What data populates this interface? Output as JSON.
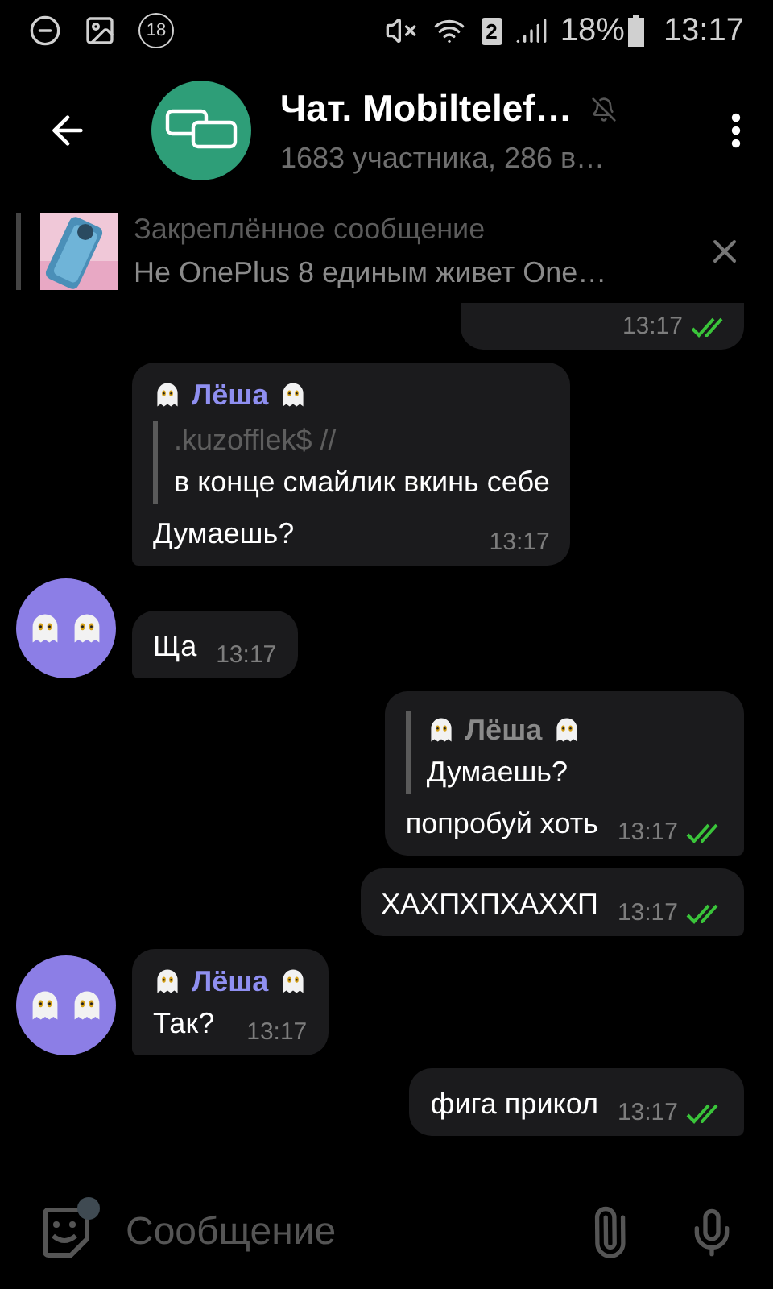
{
  "status_bar": {
    "notification_count": "18",
    "sim": "2",
    "battery": "18%",
    "time": "13:17"
  },
  "header": {
    "title": "Чат. Mobiltelef…",
    "muted": true,
    "subtitle": "1683 участника, 286 в…"
  },
  "pinned": {
    "label": "Закреплённое сообщение",
    "text": "Не OnePlus 8 единым живет One…"
  },
  "messages": [
    {
      "kind": "cut",
      "outgoing": true,
      "time": "13:17",
      "read": true
    },
    {
      "kind": "message",
      "outgoing": false,
      "sender": "Лёша",
      "reply": {
        "author": ".kuzofflek$ //",
        "text": "в конце смайлик вкинь себе"
      },
      "text": "Думаешь?",
      "time": "13:17",
      "avatar": false
    },
    {
      "kind": "message",
      "outgoing": false,
      "text": "Ща",
      "time": "13:17",
      "avatar": true
    },
    {
      "kind": "message",
      "outgoing": true,
      "reply": {
        "author": "Лёша",
        "text": "Думаешь?",
        "ghosts": true
      },
      "text": "попробуй хоть",
      "time": "13:17",
      "read": true
    },
    {
      "kind": "message",
      "outgoing": true,
      "text": "ХАХПХПХАХХП",
      "time": "13:17",
      "read": true
    },
    {
      "kind": "message",
      "outgoing": false,
      "sender": "Лёша",
      "text": "Так?",
      "time": "13:17",
      "avatar": true
    },
    {
      "kind": "message",
      "outgoing": true,
      "text": "фига прикол",
      "time": "13:17",
      "read": true
    }
  ],
  "composer": {
    "placeholder": "Сообщение",
    "sticker_badge": true
  }
}
